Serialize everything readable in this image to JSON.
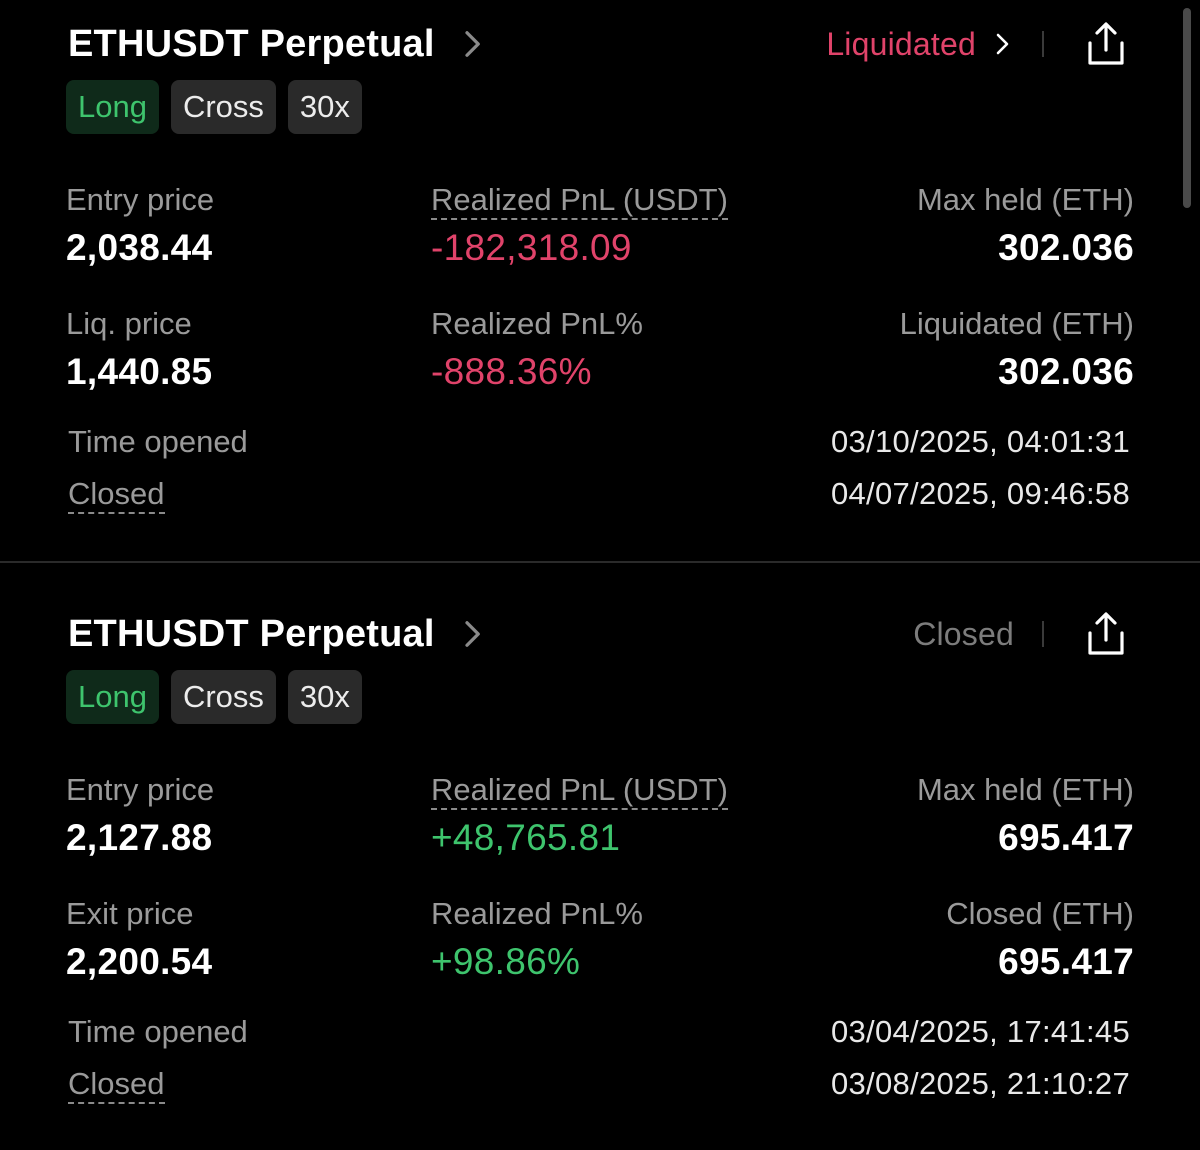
{
  "colors": {
    "background": "#000000",
    "liquidated": "#e0436a",
    "negative": "#e0436a",
    "positive": "#3ec46d",
    "closed_status": "#7c7c7c",
    "tag_long_bg": "#0f2a1a",
    "tag_bg": "#2a2a2a",
    "label": "#9a9a9a"
  },
  "icons": {
    "title_chevron": "chevron-right-icon",
    "status_chevron": "chevron-right-icon",
    "share": "share-icon"
  },
  "positions": [
    {
      "title": "ETHUSDT Perpetual",
      "status": "Liquidated",
      "tags": {
        "side": "Long",
        "margin": "Cross",
        "leverage": "30x"
      },
      "fields": {
        "entry_price_label": "Entry price",
        "entry_price": "2,038.44",
        "realized_pnl_label": "Realized PnL (USDT)",
        "realized_pnl": "-182,318.09",
        "max_held_label": "Max held (ETH)",
        "max_held": "302.036",
        "price2_label": "Liq. price",
        "price2": "1,440.85",
        "realized_pnl_pct_label": "Realized PnL%",
        "realized_pnl_pct": "-888.36%",
        "qty2_label": "Liquidated (ETH)",
        "qty2": "302.036"
      },
      "time_opened_label": "Time opened",
      "time_opened": "03/10/2025, 04:01:31",
      "closed_label": "Closed",
      "closed": "04/07/2025, 09:46:58"
    },
    {
      "title": "ETHUSDT Perpetual",
      "status": "Closed",
      "tags": {
        "side": "Long",
        "margin": "Cross",
        "leverage": "30x"
      },
      "fields": {
        "entry_price_label": "Entry price",
        "entry_price": "2,127.88",
        "realized_pnl_label": "Realized PnL (USDT)",
        "realized_pnl": "+48,765.81",
        "max_held_label": "Max held (ETH)",
        "max_held": "695.417",
        "price2_label": "Exit price",
        "price2": "2,200.54",
        "realized_pnl_pct_label": "Realized PnL%",
        "realized_pnl_pct": "+98.86%",
        "qty2_label": "Closed (ETH)",
        "qty2": "695.417"
      },
      "time_opened_label": "Time opened",
      "time_opened": "03/04/2025, 17:41:45",
      "closed_label": "Closed",
      "closed": "03/08/2025, 21:10:27"
    }
  ]
}
